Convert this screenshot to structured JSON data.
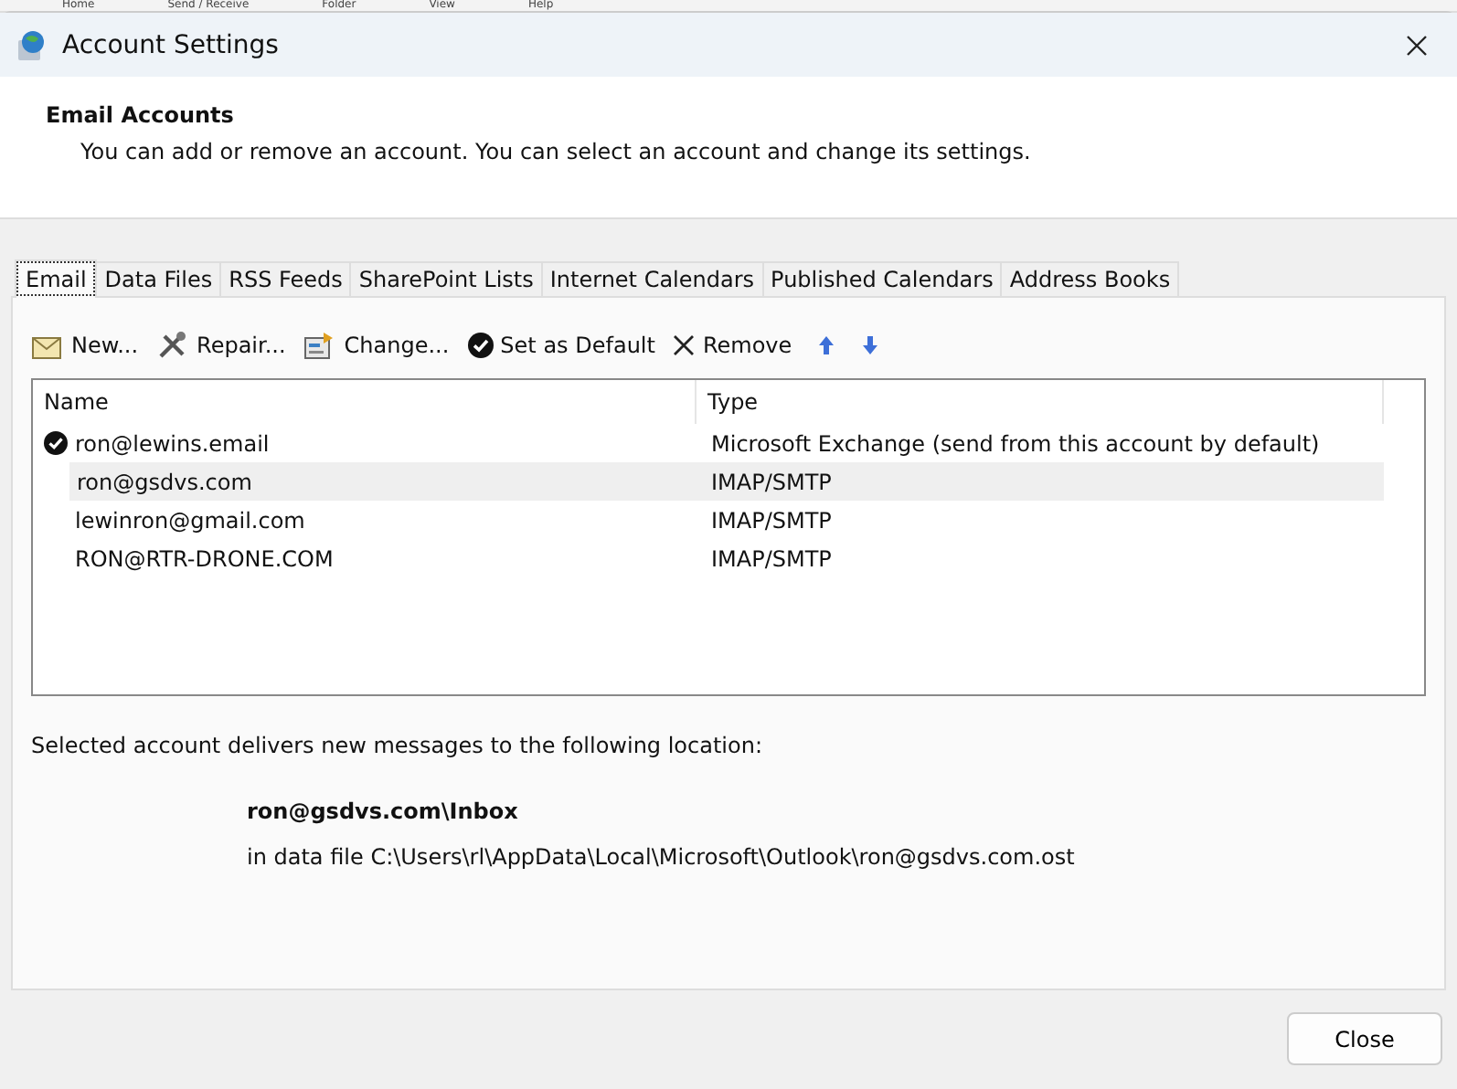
{
  "background_menu": [
    "Home",
    "Send / Receive",
    "Folder",
    "View",
    "Help"
  ],
  "window": {
    "title": "Account Settings"
  },
  "header": {
    "title": "Email Accounts",
    "description": "You can add or remove an account. You can select an account and change its settings."
  },
  "tabs": [
    {
      "label": "Email",
      "selected": true
    },
    {
      "label": "Data Files",
      "selected": false
    },
    {
      "label": "RSS Feeds",
      "selected": false
    },
    {
      "label": "SharePoint Lists",
      "selected": false
    },
    {
      "label": "Internet Calendars",
      "selected": false
    },
    {
      "label": "Published Calendars",
      "selected": false
    },
    {
      "label": "Address Books",
      "selected": false
    }
  ],
  "toolbar": [
    {
      "kind": "new",
      "label": "New..."
    },
    {
      "kind": "repair",
      "label": "Repair..."
    },
    {
      "kind": "change",
      "label": "Change..."
    },
    {
      "kind": "default",
      "label": "Set as Default"
    },
    {
      "kind": "remove",
      "label": "Remove"
    },
    {
      "kind": "up"
    },
    {
      "kind": "down"
    }
  ],
  "table": {
    "columns": [
      "Name",
      "Type"
    ],
    "rows": [
      {
        "name": "ron@lewins.email",
        "type": "Microsoft Exchange (send from this account by default)",
        "default": true,
        "selected": false
      },
      {
        "name": "ron@gsdvs.com",
        "type": "IMAP/SMTP",
        "default": false,
        "selected": true
      },
      {
        "name": "lewinron@gmail.com",
        "type": "IMAP/SMTP",
        "default": false,
        "selected": false
      },
      {
        "name": "RON@RTR-DRONE.COM",
        "type": "IMAP/SMTP",
        "default": false,
        "selected": false
      }
    ]
  },
  "location": {
    "intro": "Selected account delivers new messages to the following location:",
    "folder": "ron@gsdvs.com\\Inbox",
    "data_file": "in data file C:\\Users\\rl\\AppData\\Local\\Microsoft\\Outlook\\ron@gsdvs.com.ost"
  },
  "buttons": [
    "Close"
  ]
}
